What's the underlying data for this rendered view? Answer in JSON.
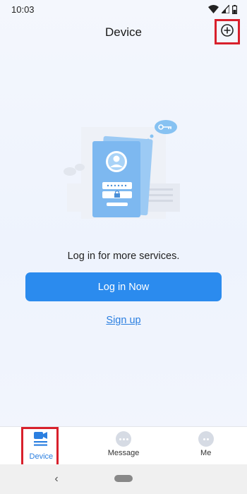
{
  "status_bar": {
    "time": "10:03",
    "icons": [
      "wifi-icon",
      "signal-icon",
      "battery-icon"
    ]
  },
  "header": {
    "title": "Device",
    "add_icon": "plus-circle-icon"
  },
  "main": {
    "prompt": "Log in for more services.",
    "login_button_label": "Log in Now",
    "signup_link_label": "Sign up"
  },
  "bottom_nav": {
    "items": [
      {
        "label": "Device",
        "icon": "video-camera-list-icon",
        "active": true
      },
      {
        "label": "Message",
        "icon": "chat-bubble-icon",
        "active": false
      },
      {
        "label": "Me",
        "icon": "profile-bubble-icon",
        "active": false
      }
    ]
  },
  "system_nav": {
    "back_glyph": "‹"
  },
  "colors": {
    "accent": "#2b8bee",
    "highlight_box": "#d8202c",
    "background": "#eef3fd"
  }
}
